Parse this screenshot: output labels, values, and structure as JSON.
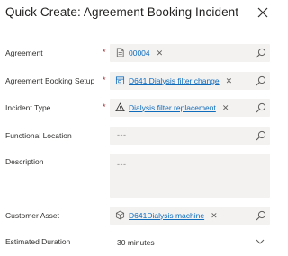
{
  "dialog": {
    "title": "Quick Create: Agreement Booking Incident"
  },
  "fields": {
    "agreement": {
      "label": "Agreement",
      "required": "*",
      "value": "00004",
      "icon": "document-icon"
    },
    "booking_setup": {
      "label": "Agreement Booking Setup",
      "required": "*",
      "value": "D641 Dialysis filter change",
      "icon": "calendar-icon"
    },
    "incident_type": {
      "label": "Incident Type",
      "required": "*",
      "value": "Dialysis filter replacement",
      "icon": "warning-icon"
    },
    "functional_location": {
      "label": "Functional Location",
      "placeholder": "---"
    },
    "description": {
      "label": "Description",
      "placeholder": "---"
    },
    "customer_asset": {
      "label": "Customer Asset",
      "value": "D641Dialysis machine",
      "icon": "asset-icon"
    },
    "estimated_duration": {
      "label": "Estimated Duration",
      "value": "30 minutes"
    }
  },
  "glyphs": {
    "remove": "✕"
  },
  "colors": {
    "link": "#0f6cbd",
    "required": "#a4262c",
    "field_bg": "#f3f2f1"
  }
}
